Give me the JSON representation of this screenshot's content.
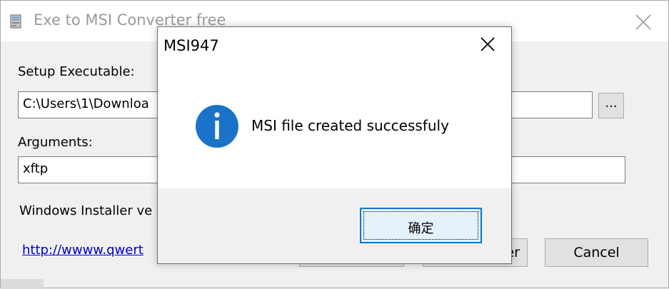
{
  "window": {
    "title": "Exe to MSI Converter free",
    "icon": "installer-app-icon",
    "close_icon": "close-icon"
  },
  "form": {
    "setup_label": "Setup Executable:",
    "setup_value": "C:\\Users\\1\\Downloa",
    "browse_label": "...",
    "arguments_label": "Arguments:",
    "arguments_value": "xftp",
    "installer_label": "Windows Installer ve",
    "link_text": "http://wwww.qwert"
  },
  "buttons": {
    "hidden_left": "",
    "hidden_right_partial": "er",
    "cancel_label": "Cancel"
  },
  "dialog": {
    "title": "MSI947",
    "message": "MSI file created successfuly",
    "ok_label": "确定",
    "icon": "info-icon",
    "colors": {
      "info_icon": "#1a73c9",
      "ok_border": "#0078d7"
    }
  }
}
